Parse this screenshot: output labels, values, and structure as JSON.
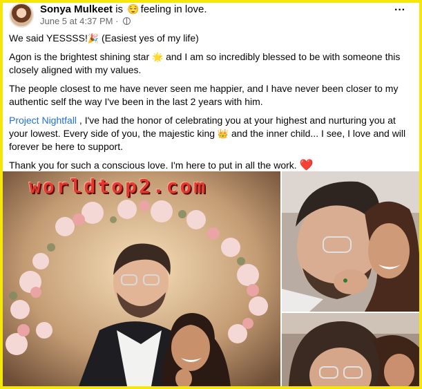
{
  "post": {
    "author_name": "Sonya Mulkeet",
    "is_word": "is",
    "feeling_emoji": "😌",
    "feeling_text": "feeling in love.",
    "timestamp": "June 5 at 4:37 PM",
    "separator": " · ",
    "privacy_icon": "globe-icon",
    "more_icon": "ellipsis-icon",
    "paragraphs": {
      "p1_text": "We said YESSSS!",
      "p1_emoji": "🎉",
      "p1_tail": " (Easiest yes of my life)",
      "p2_text": "Agon is the brightest shining star ",
      "p2_emoji": "🌟",
      "p2_tail": " and I am so incredibly blessed to be with someone this closely aligned with my values.",
      "p3_text": "The people closest to me have never seen me happier, and I have never been closer to my authentic self the way I've been in the last 2 years with him.",
      "p4_mention": "Project Nightfall",
      "p4_text": " , I've had the honor of celebrating you at your highest and nurturing you at your lowest. Every side of you, the majestic king ",
      "p4_emoji": "👑",
      "p4_tail": " and the inner child... I see, I love and will forever be here to support.",
      "p5_text": "Thank you for such a conscious love. I'm here to put in all the work. ",
      "p5_emoji": "❤️"
    }
  },
  "photos": {
    "watermark": "worldtop2.com"
  },
  "colors": {
    "page_border": "#f5e70a",
    "mention": "#216fdb",
    "meta_gray": "#65676b",
    "watermark_red": "#e23b2e"
  }
}
